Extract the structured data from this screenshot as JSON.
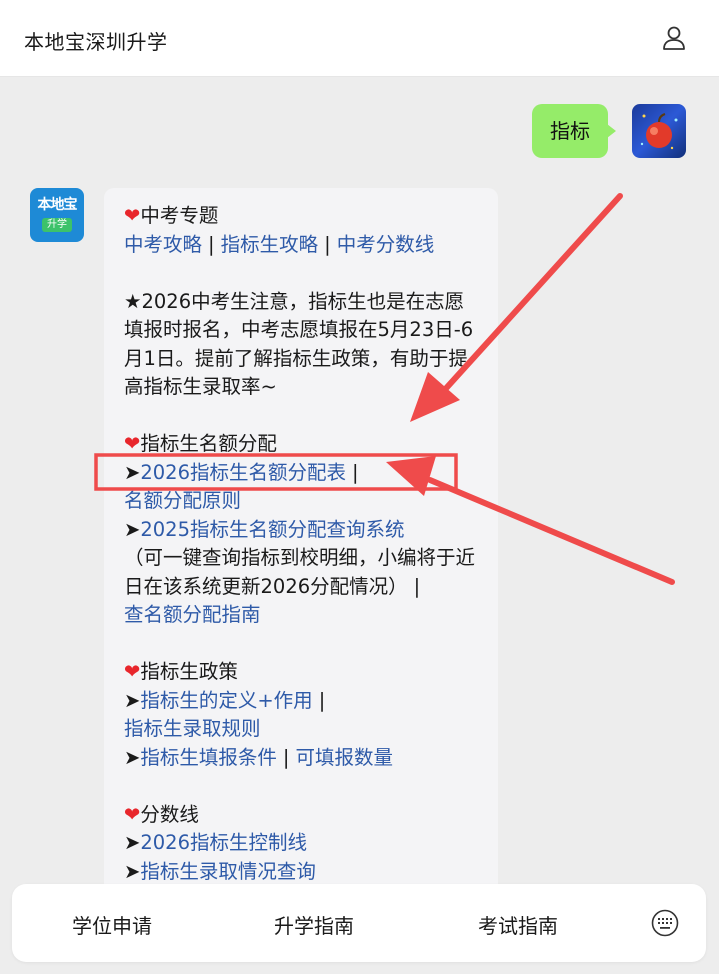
{
  "header": {
    "title": "本地宝深圳升学",
    "user_icon": "user-icon"
  },
  "chat": {
    "user_message": "指标",
    "bot_avatar": {
      "line1": "本地宝",
      "line2": "升学"
    },
    "bot_message": {
      "sections": {
        "zhongkao": {
          "heading": "中考专题",
          "links": [
            "中考攻略",
            "指标生攻略",
            "中考分数线"
          ]
        },
        "notice": "★2026中考生注意，指标生也是在志愿填报时报名，中考志愿填报在5月23日-6月1日。提前了解指标生政策，有助于提高指标生录取率~",
        "quota": {
          "heading": "指标生名额分配",
          "link1": "2026指标生名额分配表",
          "link2": "名额分配原则",
          "link3": "2025指标生名额分配查询系统",
          "note": "（可一键查询指标到校明细，小编将于近日在该系统更新2026分配情况）",
          "link4": "查名额分配指南"
        },
        "policy": {
          "heading": "指标生政策",
          "link1": "指标生的定义+作用",
          "link2": "指标生录取规则",
          "link3": "指标生填报条件",
          "link4": "可填报数量"
        },
        "scores": {
          "heading": "分数线",
          "link1": "2026指标生控制线",
          "link2": "指标生录取情况查询"
        }
      },
      "bullet": "➤",
      "separator": "|"
    }
  },
  "bottom_menu": {
    "items": [
      "学位申请",
      "升学指南",
      "考试指南"
    ],
    "keyboard_icon": "keyboard-icon"
  },
  "colors": {
    "user_bubble": "#95ec69",
    "link": "#2e5aa8",
    "annotation": "#ef4b4b",
    "heart": "#e8262c"
  }
}
